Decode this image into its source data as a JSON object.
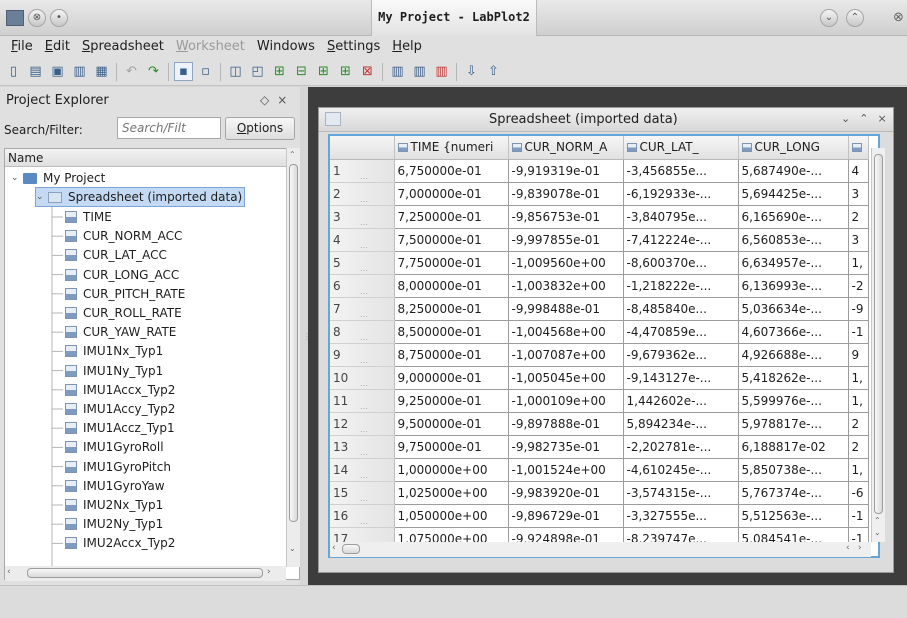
{
  "window": {
    "title": "My Project - LabPlot2"
  },
  "menubar": [
    {
      "label": "File",
      "u": "F",
      "rest": "ile",
      "enabled": true
    },
    {
      "label": "Edit",
      "u": "E",
      "rest": "dit",
      "enabled": true
    },
    {
      "label": "Spreadsheet",
      "u": "S",
      "rest": "preadsheet",
      "enabled": true
    },
    {
      "label": "Worksheet",
      "u": "W",
      "rest": "orksheet",
      "enabled": false
    },
    {
      "label": "Windows",
      "u": "",
      "rest": "Windows",
      "enabled": true
    },
    {
      "label": "Settings",
      "u": "S",
      "rest": "ettings",
      "enabled": true
    },
    {
      "label": "Help",
      "u": "H",
      "rest": "elp",
      "enabled": true
    }
  ],
  "explorer": {
    "title": "Project Explorer",
    "filter_label": "Search/Filter:",
    "filter_placeholder": "Search/Filt",
    "options_label": "Options",
    "column_header": "Name",
    "project": "My Project",
    "spreadsheet": "Spreadsheet (imported data)",
    "columns": [
      "TIME",
      "CUR_NORM_ACC",
      "CUR_LAT_ACC",
      "CUR_LONG_ACC",
      "CUR_PITCH_RATE",
      "CUR_ROLL_RATE",
      "CUR_YAW_RATE",
      "IMU1Nx_Typ1",
      "IMU1Ny_Typ1",
      "IMU1Accx_Typ2",
      "IMU1Accy_Typ2",
      "IMU1Accz_Typ1",
      "IMU1GyroRoll",
      "IMU1GyroPitch",
      "IMU1GyroYaw",
      "IMU2Nx_Typ1",
      "IMU2Ny_Typ1",
      "IMU2Accx_Typ2"
    ]
  },
  "spreadsheet": {
    "title": "Spreadsheet (imported data)",
    "headers": [
      "TIME {numeri",
      "CUR_NORM_A",
      "CUR_LAT_",
      "CUR_LONG",
      ""
    ],
    "rows": [
      [
        "1",
        "6,750000e-01",
        "-9,919319e-01",
        "-3,456855e...",
        "5,687490e-...",
        "4"
      ],
      [
        "2",
        "7,000000e-01",
        "-9,839078e-01",
        "-6,192933e-...",
        "5,694425e-...",
        "3"
      ],
      [
        "3",
        "7,250000e-01",
        "-9,856753e-01",
        "-3,840795e...",
        "6,165690e-...",
        "2"
      ],
      [
        "4",
        "7,500000e-01",
        "-9,997855e-01",
        "-7,412224e-...",
        "6,560853e-...",
        "3"
      ],
      [
        "5",
        "7,750000e-01",
        "-1,009560e+00",
        "-8,600370e...",
        "6,634957e-...",
        "1,"
      ],
      [
        "6",
        "8,000000e-01",
        "-1,003832e+00",
        "-1,218222e-...",
        "6,136993e-...",
        "-2"
      ],
      [
        "7",
        "8,250000e-01",
        "-9,998488e-01",
        "-8,485840e...",
        "5,036634e-...",
        "-9"
      ],
      [
        "8",
        "8,500000e-01",
        "-1,004568e+00",
        "-4,470859e...",
        "4,607366e-...",
        "-1"
      ],
      [
        "9",
        "8,750000e-01",
        "-1,007087e+00",
        "-9,679362e...",
        "4,926688e-...",
        "9"
      ],
      [
        "10",
        "9,000000e-01",
        "-1,005045e+00",
        "-9,143127e-...",
        "5,418262e-...",
        "1,"
      ],
      [
        "11",
        "9,250000e-01",
        "-1,000109e+00",
        "1,442602e-...",
        "5,599976e-...",
        "1,"
      ],
      [
        "12",
        "9,500000e-01",
        "-9,897888e-01",
        "5,894234e-...",
        "5,978817e-...",
        "2"
      ],
      [
        "13",
        "9,750000e-01",
        "-9,982735e-01",
        "-2,202781e-...",
        "6,188817e-02",
        "2"
      ],
      [
        "14",
        "1,000000e+00",
        "-1,001524e+00",
        "-4,610245e-...",
        "5,850738e-...",
        "1,"
      ],
      [
        "15",
        "1,025000e+00",
        "-9,983920e-01",
        "-3,574315e-...",
        "5,767374e-...",
        "-6"
      ],
      [
        "16",
        "1,050000e+00",
        "-9,896729e-01",
        "-3,327555e...",
        "5,512563e-...",
        "-1"
      ],
      [
        "17",
        "1,075000e+00",
        "-9,924898e-01",
        "-8,239747e...",
        "5,084541e-...",
        "-1"
      ]
    ]
  },
  "colors": {
    "selection": "#c4d9f3",
    "focus_border": "#64a6da",
    "mdi_background": "#3d3d3d"
  }
}
